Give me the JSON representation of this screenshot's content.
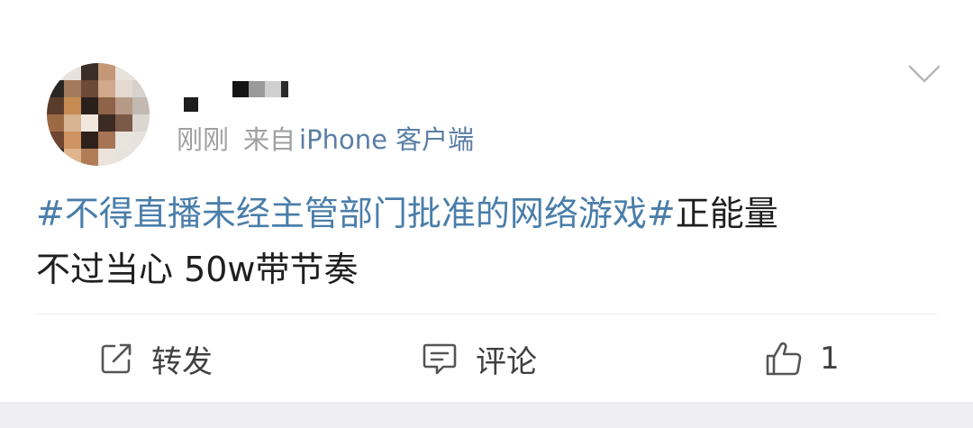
{
  "post": {
    "time": "刚刚",
    "source_prefix": "来自",
    "source": "iPhone 客户端",
    "hashtag": "#不得直播未经主管部门批准的网络游戏#",
    "text_after_tag": "正能量",
    "line2": "不过当心 50w带节奏"
  },
  "actions": {
    "repost_label": "转发",
    "comment_label": "评论",
    "like_count": "1"
  },
  "colors": {
    "link": "#4a7eaa",
    "meta": "#a0a0a0",
    "text": "#1f1f1f",
    "background": "#efeff1"
  },
  "icons": {
    "menu": "chevron-down-icon",
    "repost": "share-square-icon",
    "comment": "comment-icon",
    "like": "thumbs-up-icon"
  }
}
